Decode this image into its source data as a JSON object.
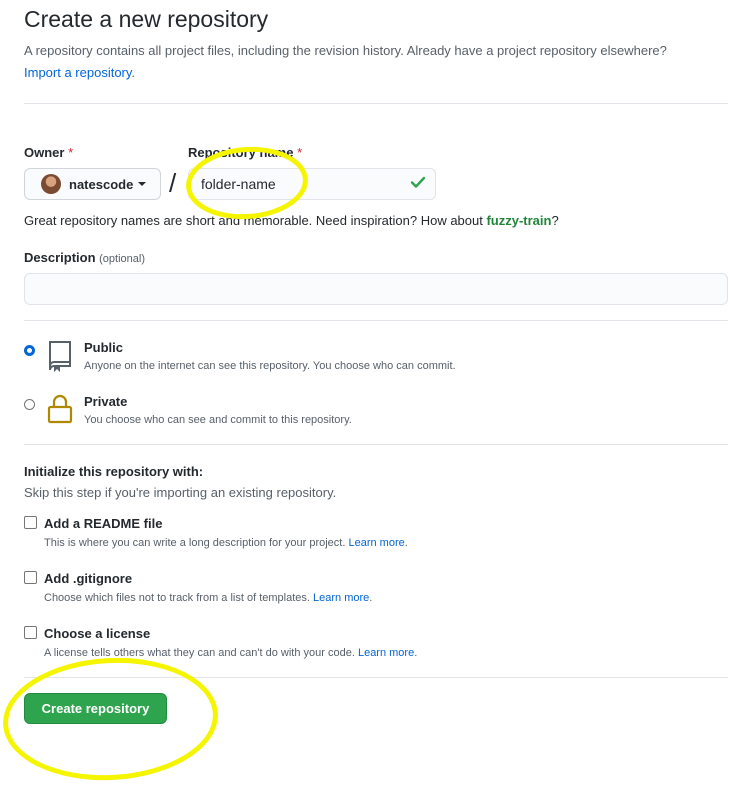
{
  "header": {
    "title": "Create a new repository",
    "subtitle": "A repository contains all project files, including the revision history. Already have a project repository elsewhere?",
    "import_link": "Import a repository",
    "period": "."
  },
  "owner": {
    "label": "Owner",
    "required_mark": "*",
    "value": "natescode"
  },
  "separator": "/",
  "repo_name": {
    "label": "Repository name",
    "required_mark": "*",
    "value": "folder-name",
    "check_icon": "check-icon"
  },
  "hint": {
    "text": "Great repository names are short and memorable. Need inspiration? How about ",
    "suggestion": "fuzzy-train",
    "end": "?"
  },
  "description": {
    "label": "Description",
    "optional": "(optional)",
    "value": ""
  },
  "visibility": {
    "public": {
      "title": "Public",
      "desc": "Anyone on the internet can see this repository. You choose who can commit.",
      "selected": true,
      "icon": "repo-book-icon"
    },
    "private": {
      "title": "Private",
      "desc": "You choose who can see and commit to this repository.",
      "selected": false,
      "icon": "lock-icon"
    }
  },
  "initialize": {
    "title": "Initialize this repository with:",
    "subtitle": "Skip this step if you're importing an existing repository.",
    "options": [
      {
        "title": "Add a README file",
        "desc": "This is where you can write a long description for your project.",
        "link": "Learn more",
        "checked": false
      },
      {
        "title": "Add .gitignore",
        "desc": "Choose which files not to track from a list of templates.",
        "link": "Learn more",
        "checked": false
      },
      {
        "title": "Choose a license",
        "desc": "A license tells others what they can and can't do with your code.",
        "link": "Learn more",
        "checked": false
      }
    ],
    "period": "."
  },
  "submit": {
    "label": "Create repository"
  },
  "colors": {
    "accent": "#0366d6",
    "primary_button": "#2ea44f",
    "highlight": "#f5f500",
    "required": "#cb2431"
  }
}
